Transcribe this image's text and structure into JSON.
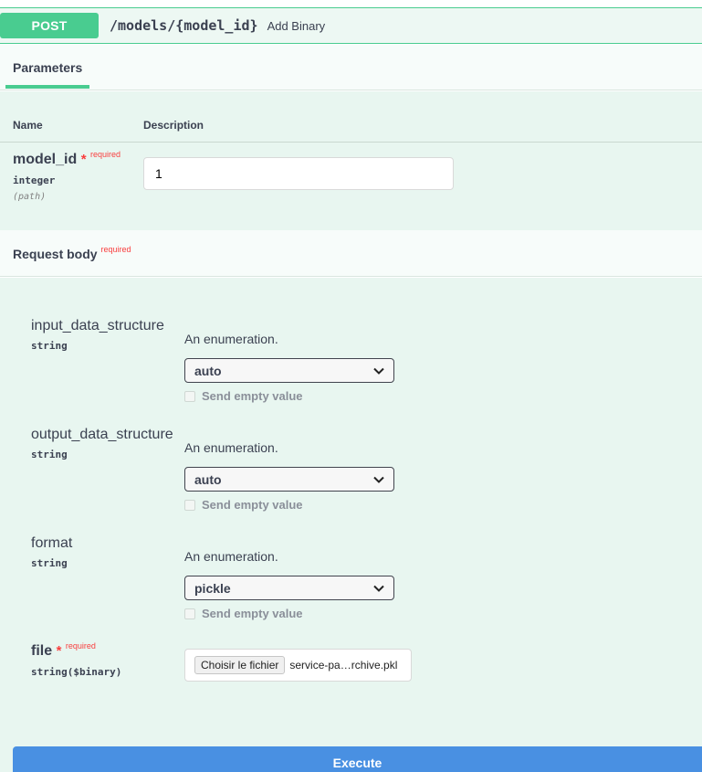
{
  "operation": {
    "method": "POST",
    "path": "/models/{model_id}",
    "summary": "Add Binary"
  },
  "parameters": {
    "tab_label": "Parameters",
    "columns": {
      "name": "Name",
      "description": "Description"
    },
    "items": [
      {
        "name": "model_id",
        "star": "*",
        "required_label": "required",
        "type": "integer",
        "in": "(path)",
        "value": "1"
      }
    ]
  },
  "request_body": {
    "title": "Request body",
    "required_label": "required",
    "fields": [
      {
        "name": "input_data_structure",
        "type": "string",
        "description": "An enumeration.",
        "selected": "auto",
        "send_empty_label": "Send empty value"
      },
      {
        "name": "output_data_structure",
        "type": "string",
        "description": "An enumeration.",
        "selected": "auto",
        "send_empty_label": "Send empty value"
      },
      {
        "name": "format",
        "type": "string",
        "description": "An enumeration.",
        "selected": "pickle",
        "send_empty_label": "Send empty value"
      }
    ],
    "file": {
      "name": "file",
      "star": "*",
      "required_label": "required",
      "type": "string($binary)",
      "button_label": "Choisir le fichier",
      "file_name": "service-pa…rchive.pkl"
    }
  },
  "execute_label": "Execute",
  "colors": {
    "post_green": "#49cc90",
    "required_red": "#f93e3e",
    "execute_blue": "#4990e2"
  }
}
